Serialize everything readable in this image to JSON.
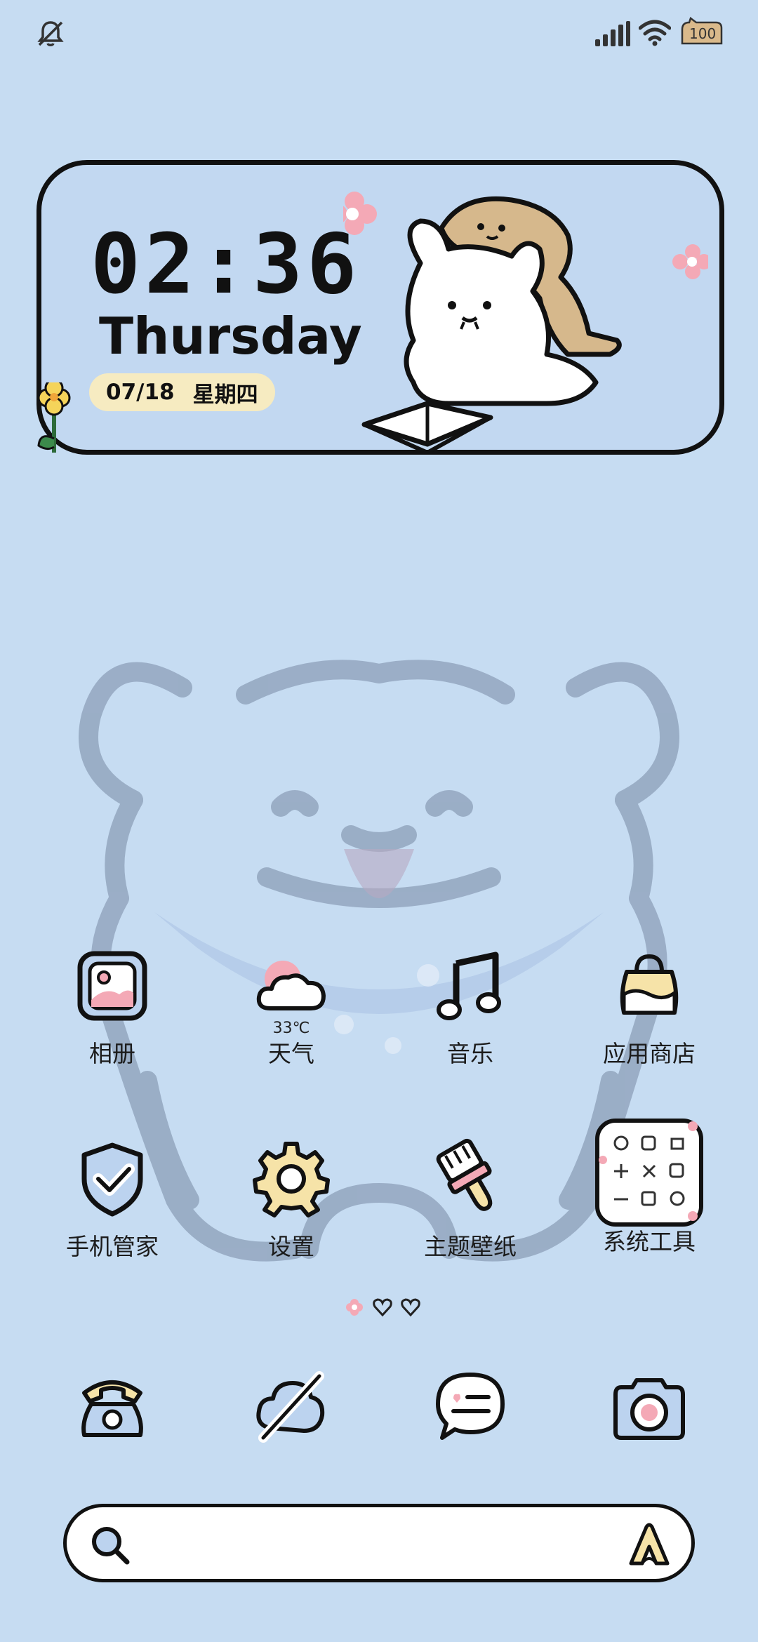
{
  "status_bar": {
    "left_icon": "bell-muted-icon",
    "signal_icon": "signal-bars-icon",
    "wifi_icon": "wifi-icon",
    "battery_level": "100"
  },
  "widget": {
    "time": "02:36",
    "weekday": "Thursday",
    "date": "07/18",
    "weekday_cn": "星期四"
  },
  "apps_row1": [
    {
      "label": "相册",
      "icon": "photo-album-icon"
    },
    {
      "label": "天气",
      "icon": "weather-cloud-icon",
      "temp": "33℃"
    },
    {
      "label": "音乐",
      "icon": "music-note-icon"
    },
    {
      "label": "应用商店",
      "icon": "shopping-bag-icon"
    }
  ],
  "apps_row2": [
    {
      "label": "手机管家",
      "icon": "shield-check-icon"
    },
    {
      "label": "设置",
      "icon": "gear-icon"
    },
    {
      "label": "主题壁纸",
      "icon": "paintbrush-icon"
    },
    {
      "label": "系统工具",
      "icon": "folder-icon"
    }
  ],
  "dock": [
    {
      "icon": "phone-icon"
    },
    {
      "icon": "browser-planet-icon"
    },
    {
      "icon": "message-bubble-icon"
    },
    {
      "icon": "camera-icon"
    }
  ],
  "page_indicator": {
    "pages": 3,
    "current": 1
  },
  "search_bar": {
    "left_icon": "search-icon",
    "right_icon": "assistant-icon"
  },
  "colors": {
    "background": "#c6dcf2",
    "outline": "#111111",
    "pink": "#f4a9b6",
    "cream": "#f6ebc1"
  }
}
